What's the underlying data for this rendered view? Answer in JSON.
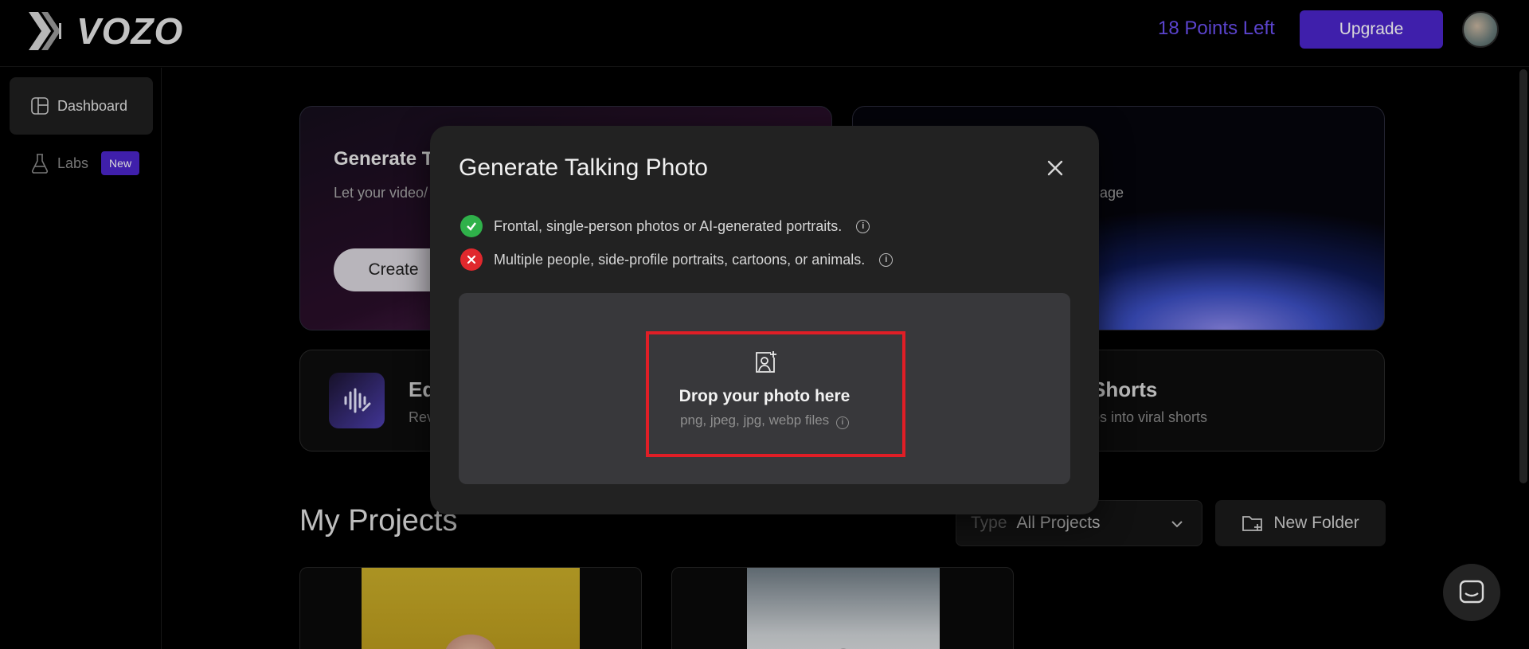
{
  "header": {
    "logo_text": "VOZO",
    "points": "18 Points Left",
    "upgrade_label": "Upgrade"
  },
  "sidebar": {
    "items": [
      {
        "label": "Dashboard",
        "icon": "dashboard-icon"
      },
      {
        "label": "Labs",
        "icon": "flask-icon",
        "badge": "New"
      }
    ]
  },
  "cards": {
    "talking_photo": {
      "title": "Generate T",
      "subtitle": "Let your video/",
      "button": "Create"
    },
    "translate": {
      "subtitle": "nguage"
    },
    "edit": {
      "title": "Ed",
      "subtitle": "Rev"
    },
    "shorts": {
      "title": "Shorts",
      "subtitle": "os into viral shorts"
    }
  },
  "projects": {
    "title": "My Projects",
    "type_label": "Type",
    "type_value": "All Projects",
    "new_folder_label": "New Folder"
  },
  "modal": {
    "title": "Generate Talking Photo",
    "rule_ok": "Frontal, single-person photos or AI-generated portraits.",
    "rule_bad": "Multiple people, side-profile portraits, cartoons, or animals.",
    "drop_title": "Drop your photo here",
    "drop_sub": "png, jpeg, jpg, webp files"
  },
  "colors": {
    "accent": "#4a25c9",
    "points": "#6a4ff0",
    "ok": "#2fb14a",
    "bad": "#e0282d",
    "highlight": "#e01e26"
  }
}
